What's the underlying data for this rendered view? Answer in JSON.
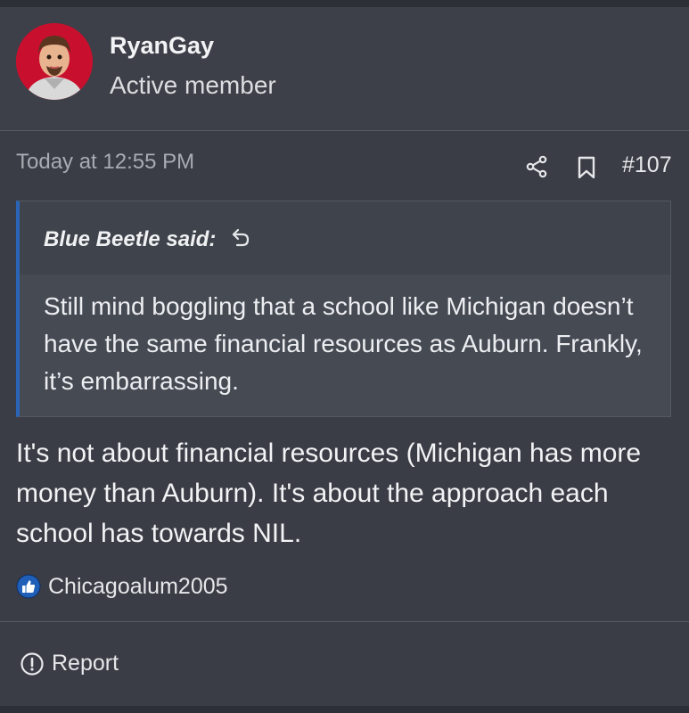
{
  "user": {
    "name": "RyanGay",
    "title": "Active member"
  },
  "post": {
    "time": "Today at 12:55 PM",
    "number": "#107",
    "body": "It's not about financial resources (Michigan has more money than Auburn). It's about the approach each school has towards NIL."
  },
  "quote": {
    "author": "Blue Beetle said:",
    "text": "Still mind boggling that a school like Michigan doesn’t have the same financial resources as Auburn. Frankly, it’s embarrassing."
  },
  "reactions": {
    "icon": "thumbs-up-icon",
    "user": "Chicagoalum2005"
  },
  "actions": {
    "report_label": "Report",
    "share_icon": "share-icon",
    "bookmark_icon": "bookmark-icon"
  },
  "colors": {
    "background": "#3a3d45",
    "quote_accent": "#2a64b6",
    "avatar_red": "#c8102e"
  }
}
